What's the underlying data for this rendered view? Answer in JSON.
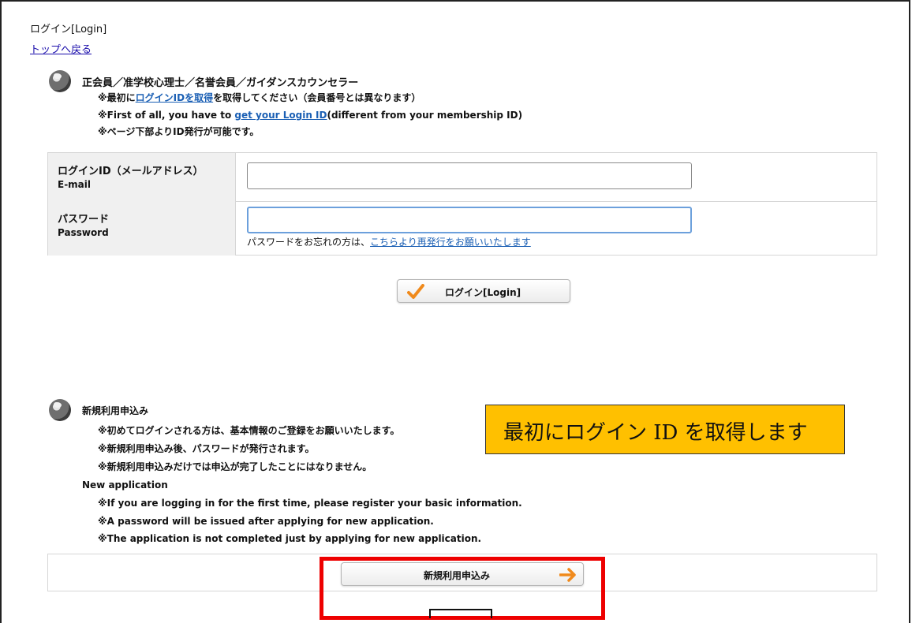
{
  "header": {
    "title": "ログイン[Login]",
    "back_link": "トップへ戻る"
  },
  "members": {
    "heading": "正会員／准学校心理士／名誉会員／ガイダンスカウンセラー",
    "note1_pre": "※最初に",
    "note1_link": "ログインIDを取得",
    "note1_post": "を取得してください（会員番号とは異なります）",
    "note2_pre": "※First of all, you have to ",
    "note2_link": "get your Login ID",
    "note2_post": "(different from your membership ID)",
    "note3": "※ページ下部よりID発行が可能です。"
  },
  "form": {
    "email_label_jp": "ログインID（メールアドレス）",
    "email_label_en": "E-mail",
    "email_value": "",
    "password_label_jp": "パスワード",
    "password_label_en": "Password",
    "password_value": "",
    "forgot_pre": "パスワードをお忘れの方は、",
    "forgot_link": "こちらより再発行をお願いいたします"
  },
  "login_button": {
    "label": "ログイン[Login]",
    "icon": "checkmark-icon",
    "icon_color": "#f08a1c"
  },
  "new_application": {
    "heading": "新規利用申込み",
    "jp_notes": [
      "※初めてログインされる方は、基本情報のご登録をお願いいたします。",
      "※新規利用申込み後、パスワードが発行されます。",
      "※新規利用申込みだけでは申込が完了したことにはなりません。"
    ],
    "en_heading": "New application",
    "en_notes": [
      "※If you are logging in for the first time, please register your basic information.",
      "※A password will be issued after applying for new application.",
      "※The application is not completed just by applying for new application."
    ],
    "button_label": "新規利用申込み",
    "button_icon": "arrow-right-icon",
    "icon_color": "#f08a1c"
  },
  "annotation": {
    "callout_text": "最初にログイン ID を取得します",
    "callout_color": "#ffc000",
    "highlight_color": "#ee0000"
  }
}
